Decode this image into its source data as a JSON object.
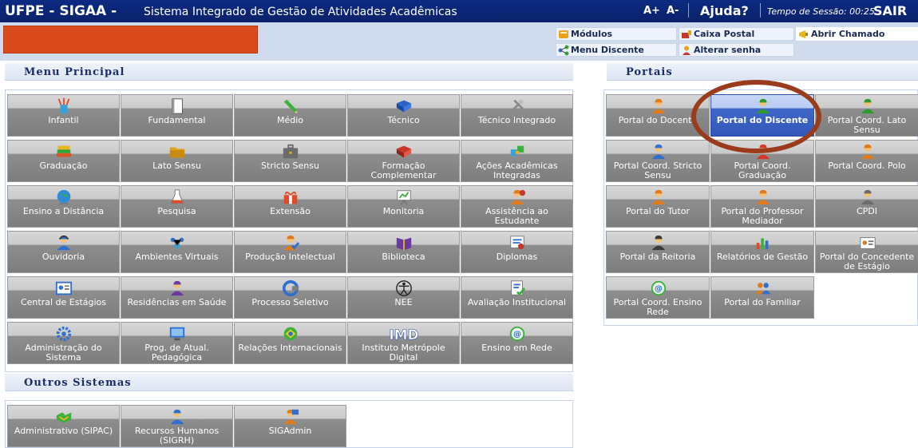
{
  "header": {
    "app_title": "UFPE - SIGAA -",
    "app_subtitle": "Sistema Integrado de Gestão de Atividades Acadêmicas",
    "font_increase": "A+",
    "font_decrease": "A-",
    "help": "Ajuda?",
    "session": "Tempo de Sessão: 00:25",
    "exit": "SAIR"
  },
  "quicklinks": {
    "modulos": "Módulos",
    "caixa_postal": "Caixa Postal",
    "abrir_chamado": "Abrir Chamado",
    "menu_discente": "Menu Discente",
    "alterar_senha": "Alterar senha"
  },
  "sections": {
    "menu_principal": "Menu Principal",
    "portais": "Portais",
    "outros_sistemas": "Outros Sistemas"
  },
  "menu_principal": [
    {
      "label": "Infantil",
      "icon": "pencil-cup-icon"
    },
    {
      "label": "Fundamental",
      "icon": "notebook-icon"
    },
    {
      "label": "Médio",
      "icon": "pencil-icon"
    },
    {
      "label": "Técnico",
      "icon": "book-blue-icon"
    },
    {
      "label": "Técnico Integrado",
      "icon": "tools-icon"
    },
    {
      "label": "Graduação",
      "icon": "books-stack-icon"
    },
    {
      "label": "Lato Sensu",
      "icon": "folder-icon"
    },
    {
      "label": "Stricto Sensu",
      "icon": "briefcase-icon"
    },
    {
      "label": "Formação Complementar",
      "icon": "book-red-icon"
    },
    {
      "label": "Ações Acadêmicas Integradas",
      "icon": "puzzle-icon"
    },
    {
      "label": "Ensino a Distância",
      "icon": "globe-icon"
    },
    {
      "label": "Pesquisa",
      "icon": "flask-icon"
    },
    {
      "label": "Extensão",
      "icon": "gift-icon"
    },
    {
      "label": "Monitoria",
      "icon": "presentation-icon"
    },
    {
      "label": "Assistência ao Estudante",
      "icon": "support-person-icon"
    },
    {
      "label": "Ouvidoria",
      "icon": "headset-person-icon"
    },
    {
      "label": "Ambientes Virtuais",
      "icon": "network-people-icon"
    },
    {
      "label": "Produção Intelectual",
      "icon": "user-check-icon"
    },
    {
      "label": "Biblioteca",
      "icon": "book-open-icon"
    },
    {
      "label": "Diplomas",
      "icon": "certificate-icon"
    },
    {
      "label": "Central de Estágios",
      "icon": "id-card-icon"
    },
    {
      "label": "Residências em Saúde",
      "icon": "health-person-icon"
    },
    {
      "label": "Processo Seletivo",
      "icon": "c-logo-icon"
    },
    {
      "label": "NEE",
      "icon": "accessibility-icon"
    },
    {
      "label": "Avaliação Institucional",
      "icon": "form-check-icon"
    },
    {
      "label": "Administração do Sistema",
      "icon": "gear-icon"
    },
    {
      "label": "Prog. de Atual. Pedagógica",
      "icon": "monitor-icon"
    },
    {
      "label": "Relações Internacionais",
      "icon": "globe-brazil-icon"
    },
    {
      "label": "Instituto Metrópole Digital",
      "icon": "imd-logo-icon",
      "logo_text": "IMD"
    },
    {
      "label": "Ensino em Rede",
      "icon": "network-globe-icon"
    }
  ],
  "outros_sistemas": [
    {
      "label": "Administrativo (SIPAC)",
      "icon": "handshake-icon"
    },
    {
      "label": "Recursos Humanos (SIGRH)",
      "icon": "person-blue-icon"
    },
    {
      "label": "SIGAdmin",
      "icon": "admin-user-icon"
    }
  ],
  "portais": [
    {
      "label": "Portal do Docente",
      "icon": "person-orange-icon"
    },
    {
      "label": "Portal do Discente",
      "icon": "person-green-icon",
      "active": true
    },
    {
      "label": "Portal Coord. Lato Sensu",
      "icon": "person-green-icon"
    },
    {
      "label": "Portal Coord. Stricto Sensu",
      "icon": "person-blue-icon"
    },
    {
      "label": "Portal Coord. Graduação",
      "icon": "person-red-icon"
    },
    {
      "label": "Portal Coord. Polo",
      "icon": "person-orange-icon"
    },
    {
      "label": "Portal do Tutor",
      "icon": "person-orange-icon"
    },
    {
      "label": "Portal do Professor Mediador",
      "icon": "person-orange-icon"
    },
    {
      "label": "CPDI",
      "icon": "person-gray-icon"
    },
    {
      "label": "Portal da Reitoria",
      "icon": "person-suit-icon"
    },
    {
      "label": "Relatórios de Gestão",
      "icon": "charts-icon"
    },
    {
      "label": "Portal do Concedente de Estágio",
      "icon": "id-badge-icon"
    },
    {
      "label": "Portal Coord. Ensino Rede",
      "icon": "network-globe-icon"
    },
    {
      "label": "Portal do Familiar",
      "icon": "family-icon"
    }
  ],
  "colors": {
    "topbar": "#0c2a82",
    "user_block": "#d94b1c",
    "tile_active": "#3257b9",
    "highlight_ring": "#9a3b1c"
  }
}
